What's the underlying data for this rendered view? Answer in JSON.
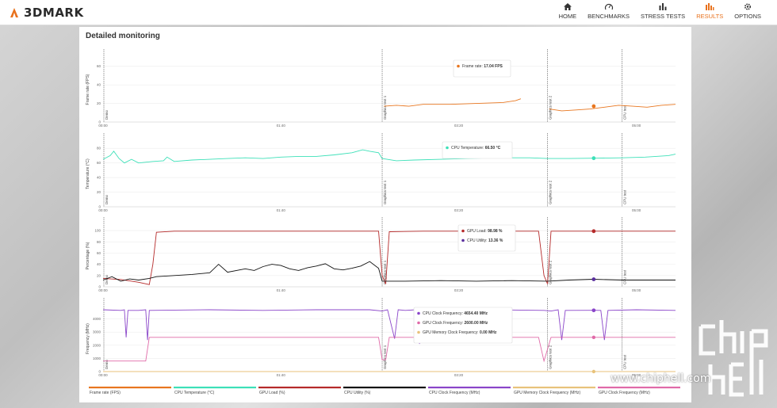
{
  "app": {
    "brand": "3DMARK"
  },
  "nav": [
    {
      "label": "HOME",
      "icon": "home-icon",
      "active": false
    },
    {
      "label": "BENCHMARKS",
      "icon": "benchmarks-icon",
      "active": false
    },
    {
      "label": "STRESS TESTS",
      "icon": "stress-tests-icon",
      "active": false
    },
    {
      "label": "RESULTS",
      "icon": "results-icon",
      "active": true
    },
    {
      "label": "OPTIONS",
      "icon": "gear-icon",
      "active": false
    }
  ],
  "colors": {
    "frame_rate": "#e8761f",
    "cpu_temp": "#3de0b8",
    "gpu_load": "#b52a2a",
    "cpu_utility": "#111111",
    "cpu_clock": "#8a45c9",
    "gpu_clock": "#e06aa8",
    "gpu_mem_clock": "#e8c27a",
    "accent": "#e8711c"
  },
  "panel": {
    "title": "Detailed monitoring"
  },
  "markers": [
    "Demo",
    "Graphics test 1",
    "Graphics test 2",
    "CPU test"
  ],
  "tooltips": {
    "fps": [
      {
        "label": "Frame rate:",
        "value": "17.04 FPS",
        "color": "#e8761f"
      }
    ],
    "temp": [
      {
        "label": "CPU Temperature:",
        "value": "66.50 °C",
        "color": "#3de0b8"
      }
    ],
    "pct": [
      {
        "label": "GPU Load:",
        "value": "98.98 %",
        "color": "#b52a2a"
      },
      {
        "label": "CPU Utility:",
        "value": "13.36 %",
        "color": "#5a2f9e"
      }
    ],
    "freq": [
      {
        "label": "CPU Clock Frequency:",
        "value": "4654.40 MHz",
        "color": "#8a45c9"
      },
      {
        "label": "GPU Clock Frequency:",
        "value": "2600.00 MHz",
        "color": "#e06aa8"
      },
      {
        "label": "GPU Memory Clock Frequency:",
        "value": "0.00 MHz",
        "color": "#e8c27a"
      }
    ]
  },
  "legend": [
    {
      "label": "Frame rate (FPS)",
      "color": "#e8761f"
    },
    {
      "label": "CPU Temperature (°C)",
      "color": "#3de0b8"
    },
    {
      "label": "GPU Load (%)",
      "color": "#b52a2a"
    },
    {
      "label": "CPU Utility (%)",
      "color": "#111111"
    },
    {
      "label": "CPU Clock Frequency (MHz)",
      "color": "#8a45c9"
    },
    {
      "label": "GPU Memory Clock Frequency (MHz)",
      "color": "#e8c27a"
    },
    {
      "label": "GPU Clock Frequency (MHz)",
      "color": "#e06aa8"
    }
  ],
  "watermark": {
    "text": "www.chiphell.com"
  },
  "chart_data": [
    {
      "type": "line",
      "ylabel": "Frame rate (FPS)",
      "ylim": [
        0,
        70
      ],
      "yticks": [
        "0",
        "20",
        "40",
        "60"
      ],
      "xticks": [
        "00:00",
        "01:40",
        "03:20",
        "05:00"
      ],
      "xlim": [
        0,
        322
      ],
      "series": [
        {
          "name": "Frame rate (FPS)",
          "color": "#e8761f",
          "points": [
            [
              0,
              null
            ],
            [
              157,
              null
            ],
            [
              158,
              17
            ],
            [
              165,
              18
            ],
            [
              172,
              17
            ],
            [
              180,
              19
            ],
            [
              195,
              19
            ],
            [
              210,
              20
            ],
            [
              225,
              21
            ],
            [
              232,
              23
            ],
            [
              235,
              25
            ],
            [
              236,
              null
            ],
            [
              250,
              null
            ],
            [
              251,
              14
            ],
            [
              258,
              12
            ],
            [
              266,
              13
            ],
            [
              274,
              14
            ],
            [
              282,
              16
            ],
            [
              290,
              18
            ],
            [
              298,
              17
            ],
            [
              306,
              16
            ],
            [
              314,
              18
            ],
            [
              322,
              19
            ]
          ]
        }
      ],
      "markers": [
        {
          "t": 157,
          "label": "Graphics test 1"
        },
        {
          "t": 250,
          "label": "Graphics test 2"
        },
        {
          "t": 0,
          "label": "Demo"
        }
      ],
      "highlight": {
        "t": 276,
        "v": 17.04
      }
    },
    {
      "type": "line",
      "ylabel": "Temperature (°C)",
      "ylim": [
        0,
        90
      ],
      "yticks": [
        "0",
        "20",
        "40",
        "60",
        "80"
      ],
      "xticks": [
        "00:00",
        "01:40",
        "03:20",
        "05:00"
      ],
      "xlim": [
        0,
        322
      ],
      "series": [
        {
          "name": "CPU Temperature (°C)",
          "color": "#3de0b8",
          "points": [
            [
              0,
              65
            ],
            [
              4,
              70
            ],
            [
              6,
              76
            ],
            [
              9,
              66
            ],
            [
              12,
              60
            ],
            [
              16,
              65
            ],
            [
              20,
              60
            ],
            [
              28,
              62
            ],
            [
              34,
              63
            ],
            [
              36,
              68
            ],
            [
              40,
              62
            ],
            [
              50,
              64
            ],
            [
              60,
              65
            ],
            [
              70,
              66
            ],
            [
              80,
              67
            ],
            [
              90,
              66
            ],
            [
              100,
              68
            ],
            [
              110,
              69
            ],
            [
              120,
              69
            ],
            [
              130,
              71
            ],
            [
              140,
              74
            ],
            [
              146,
              78
            ],
            [
              150,
              76
            ],
            [
              155,
              74
            ],
            [
              157,
              66
            ],
            [
              165,
              63
            ],
            [
              175,
              64
            ],
            [
              190,
              65
            ],
            [
              205,
              66
            ],
            [
              220,
              67
            ],
            [
              240,
              67
            ],
            [
              250,
              66
            ],
            [
              262,
              66
            ],
            [
              276,
              66.5
            ],
            [
              292,
              67
            ],
            [
              305,
              68
            ],
            [
              318,
              70
            ],
            [
              322,
              72
            ]
          ]
        }
      ],
      "markers": [
        {
          "t": 157,
          "label": "Graphics test 1"
        },
        {
          "t": 250,
          "label": "Graphics test 2"
        },
        {
          "t": 0,
          "label": "Demo"
        }
      ],
      "highlight": {
        "t": 276,
        "v": 66.5
      }
    },
    {
      "type": "line",
      "ylabel": "Percentage (%)",
      "ylim": [
        0,
        110
      ],
      "yticks": [
        "0",
        "20",
        "40",
        "60",
        "80",
        "100"
      ],
      "xticks": [
        "00:00",
        "01:40",
        "03:20",
        "05:00"
      ],
      "xlim": [
        0,
        322
      ],
      "series": [
        {
          "name": "GPU Load (%)",
          "color": "#b52a2a",
          "points": [
            [
              0,
              15
            ],
            [
              10,
              13
            ],
            [
              20,
              8
            ],
            [
              26,
              4
            ],
            [
              28,
              40
            ],
            [
              30,
              97
            ],
            [
              40,
              99
            ],
            [
              80,
              99
            ],
            [
              120,
              99
            ],
            [
              155,
              99
            ],
            [
              157,
              20
            ],
            [
              159,
              5
            ],
            [
              161,
              98
            ],
            [
              180,
              99
            ],
            [
              215,
              99
            ],
            [
              230,
              99
            ],
            [
              245,
              99
            ],
            [
              248,
              20
            ],
            [
              250,
              5
            ],
            [
              252,
              99
            ],
            [
              276,
              99
            ],
            [
              300,
              99
            ],
            [
              322,
              99
            ]
          ]
        },
        {
          "name": "CPU Utility (%)",
          "color": "#111111",
          "points": [
            [
              0,
              12
            ],
            [
              5,
              18
            ],
            [
              10,
              10
            ],
            [
              15,
              14
            ],
            [
              20,
              12
            ],
            [
              26,
              15
            ],
            [
              30,
              18
            ],
            [
              40,
              20
            ],
            [
              50,
              22
            ],
            [
              60,
              25
            ],
            [
              65,
              40
            ],
            [
              70,
              26
            ],
            [
              80,
              32
            ],
            [
              85,
              29
            ],
            [
              90,
              36
            ],
            [
              95,
              40
            ],
            [
              100,
              38
            ],
            [
              105,
              32
            ],
            [
              110,
              29
            ],
            [
              115,
              34
            ],
            [
              120,
              37
            ],
            [
              125,
              41
            ],
            [
              130,
              32
            ],
            [
              135,
              30
            ],
            [
              140,
              33
            ],
            [
              145,
              37
            ],
            [
              150,
              45
            ],
            [
              155,
              33
            ],
            [
              157,
              10
            ],
            [
              170,
              10
            ],
            [
              190,
              11
            ],
            [
              210,
              10
            ],
            [
              230,
              11
            ],
            [
              250,
              10
            ],
            [
              262,
              12
            ],
            [
              276,
              13.36
            ],
            [
              292,
              12
            ],
            [
              310,
              12
            ],
            [
              322,
              12
            ]
          ]
        }
      ],
      "markers": [
        {
          "t": 157,
          "label": "Graphics test 1"
        },
        {
          "t": 250,
          "label": "Graphics test 2"
        },
        {
          "t": 0,
          "label": "Demo"
        }
      ],
      "highlight_a": {
        "t": 276,
        "v": 98.98
      },
      "highlight_b": {
        "t": 276,
        "v": 13.36
      }
    },
    {
      "type": "line",
      "ylabel": "Frequency (MHz)",
      "ylim": [
        0,
        5000
      ],
      "yticks": [
        "0",
        "1000",
        "2000",
        "3000",
        "4000"
      ],
      "xticks": [
        "00:00",
        "01:40",
        "03:20",
        "05:00"
      ],
      "xlim": [
        0,
        322
      ],
      "series": [
        {
          "name": "CPU Clock Frequency (MHz)",
          "color": "#8a45c9",
          "points": [
            [
              0,
              4700
            ],
            [
              10,
              4650
            ],
            [
              12,
              4700
            ],
            [
              13,
              2600
            ],
            [
              14,
              4650
            ],
            [
              20,
              4650
            ],
            [
              24,
              4700
            ],
            [
              25,
              2400
            ],
            [
              26,
              4650
            ],
            [
              60,
              4700
            ],
            [
              90,
              4650
            ],
            [
              120,
              4700
            ],
            [
              150,
              4700
            ],
            [
              157,
              4600
            ],
            [
              160,
              4700
            ],
            [
              164,
              2500
            ],
            [
              166,
              4700
            ],
            [
              170,
              4650
            ],
            [
              176,
              4700
            ],
            [
              178,
              2100
            ],
            [
              180,
              4650
            ],
            [
              190,
              4700
            ],
            [
              192,
              2500
            ],
            [
              194,
              4650
            ],
            [
              220,
              4700
            ],
            [
              248,
              4650
            ],
            [
              252,
              4600
            ],
            [
              256,
              4700
            ],
            [
              258,
              2400
            ],
            [
              260,
              4650
            ],
            [
              276,
              4654
            ],
            [
              280,
              4650
            ],
            [
              282,
              2400
            ],
            [
              284,
              4650
            ],
            [
              300,
              4700
            ],
            [
              322,
              4650
            ]
          ]
        },
        {
          "name": "GPU Clock Frequency (MHz)",
          "color": "#e06aa8",
          "points": [
            [
              0,
              800
            ],
            [
              24,
              800
            ],
            [
              26,
              2600
            ],
            [
              60,
              2600
            ],
            [
              100,
              2600
            ],
            [
              140,
              2600
            ],
            [
              155,
              2600
            ],
            [
              157,
              900
            ],
            [
              159,
              900
            ],
            [
              161,
              2600
            ],
            [
              200,
              2600
            ],
            [
              245,
              2600
            ],
            [
              248,
              800
            ],
            [
              252,
              2600
            ],
            [
              276,
              2600
            ],
            [
              300,
              2600
            ],
            [
              322,
              2600
            ]
          ]
        },
        {
          "name": "GPU Memory Clock Frequency (MHz)",
          "color": "#e8c27a",
          "points": [
            [
              0,
              0
            ],
            [
              100,
              0
            ],
            [
              200,
              0
            ],
            [
              276,
              0
            ],
            [
              322,
              0
            ]
          ]
        }
      ],
      "markers": [
        {
          "t": 157,
          "label": "Graphics test 1"
        },
        {
          "t": 250,
          "label": "Graphics test 2"
        },
        {
          "t": 0,
          "label": "Demo"
        }
      ],
      "highlight": {
        "t": 276,
        "v": 4654.4
      }
    }
  ]
}
